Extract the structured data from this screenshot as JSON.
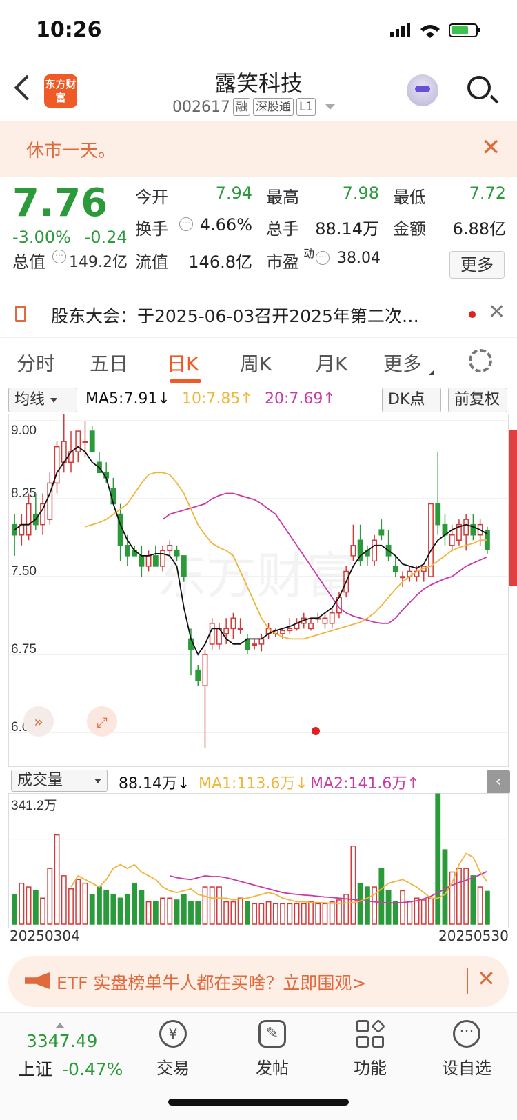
{
  "status": {
    "time": "10:26"
  },
  "header": {
    "back_icon": "chevron-left-icon",
    "logo_text": "东方财富",
    "title": "露笑科技",
    "code": "002617",
    "tags": [
      "融",
      "深股通",
      "L1"
    ]
  },
  "notice": {
    "text": "休市一天。"
  },
  "quote": {
    "price": "7.76",
    "change_pct": "-3.00%",
    "change_amt": "-0.24",
    "fields": {
      "open_label": "今开",
      "open": "7.94",
      "high_label": "最高",
      "high": "7.98",
      "low_label": "最低",
      "low": "7.72",
      "turnover_label": "换手",
      "turnover": "4.66%",
      "volume_label": "总手",
      "volume": "88.14万",
      "amount_label": "金额",
      "amount": "6.88亿",
      "mktcap_label": "总值",
      "mktcap": "149.2亿",
      "float_label": "流值",
      "float": "146.8亿",
      "pe_label": "市盈",
      "pe_sup": "动",
      "pe": "38.04"
    },
    "more_label": "更多"
  },
  "announcement": {
    "text": "股东大会：于2025-06-03召开2025年第二次…"
  },
  "tabs": [
    "分时",
    "五日",
    "日K",
    "周K",
    "月K",
    "更多"
  ],
  "active_tab": "日K",
  "ma_row": {
    "select": "均线",
    "ma5": "MA5:7.91↓",
    "ma10": "10:7.85↑",
    "ma20": "20:7.69↑",
    "dk": "DK点",
    "adjust": "前复权"
  },
  "vol_row": {
    "select": "成交量",
    "vol": "88.14万↓",
    "ma1": "MA1:113.6万↓",
    "ma2": "MA2:141.6万↑"
  },
  "colors": {
    "up": "#d23a3a",
    "down": "#2a9a3a",
    "ma5": "#111111",
    "ma10": "#f0b53a",
    "ma20": "#c83aa8",
    "accent": "#ef5a26"
  },
  "chart_data": [
    {
      "type": "candlestick",
      "y_ticks": [
        "9.00",
        "8.25",
        "7.50",
        "6.75",
        "6.00"
      ],
      "ylim": [
        6.0,
        9.0
      ],
      "x_start": "20250304",
      "x_end": "20250530",
      "watermark": "东方财富",
      "ohlc": [
        [
          8.0,
          8.1,
          7.7,
          7.9
        ],
        [
          7.9,
          8.1,
          7.8,
          8.0
        ],
        [
          7.9,
          8.3,
          7.85,
          8.2
        ],
        [
          8.1,
          8.3,
          7.95,
          8.0
        ],
        [
          8.0,
          8.3,
          7.9,
          8.2
        ],
        [
          8.05,
          8.5,
          8.0,
          8.4
        ],
        [
          8.4,
          8.8,
          8.3,
          8.75
        ],
        [
          8.6,
          9.1,
          8.5,
          8.8
        ],
        [
          8.6,
          8.9,
          8.5,
          8.7
        ],
        [
          8.7,
          8.9,
          8.6,
          8.9
        ],
        [
          8.8,
          9.0,
          8.65,
          8.8
        ],
        [
          8.9,
          8.95,
          8.7,
          8.7
        ],
        [
          8.6,
          8.7,
          8.5,
          8.5
        ],
        [
          8.5,
          8.6,
          8.4,
          8.45
        ],
        [
          8.35,
          8.45,
          8.2,
          8.2
        ],
        [
          8.1,
          8.2,
          7.65,
          7.8
        ],
        [
          7.8,
          7.9,
          7.6,
          7.7
        ],
        [
          7.75,
          7.8,
          7.7,
          7.7
        ],
        [
          7.7,
          7.8,
          7.5,
          7.6
        ],
        [
          7.6,
          7.75,
          7.55,
          7.7
        ],
        [
          7.7,
          7.8,
          7.6,
          7.6
        ],
        [
          7.6,
          7.8,
          7.55,
          7.75
        ],
        [
          7.75,
          7.85,
          7.7,
          7.8
        ],
        [
          7.75,
          7.8,
          7.65,
          7.7
        ],
        [
          7.7,
          7.7,
          7.45,
          7.5
        ],
        [
          6.9,
          7.0,
          6.55,
          6.8
        ],
        [
          6.6,
          6.65,
          6.45,
          6.5
        ],
        [
          6.45,
          6.8,
          5.85,
          6.75
        ],
        [
          6.85,
          7.1,
          6.8,
          7.05
        ],
        [
          6.85,
          7.05,
          6.8,
          7.0
        ],
        [
          6.95,
          7.1,
          6.85,
          7.0
        ],
        [
          7.0,
          7.15,
          6.9,
          7.1
        ],
        [
          7.0,
          7.1,
          6.95,
          7.0
        ],
        [
          6.9,
          6.95,
          6.75,
          6.8
        ],
        [
          6.85,
          6.9,
          6.8,
          6.85
        ],
        [
          6.85,
          6.95,
          6.78,
          6.9
        ],
        [
          6.95,
          7.05,
          6.9,
          7.0
        ],
        [
          6.95,
          7.0,
          6.92,
          6.98
        ],
        [
          6.95,
          7.0,
          6.9,
          6.98
        ],
        [
          6.98,
          7.1,
          6.95,
          7.0
        ],
        [
          7.0,
          7.1,
          6.98,
          7.05
        ],
        [
          7.05,
          7.15,
          7.0,
          7.1
        ],
        [
          7.0,
          7.1,
          6.98,
          7.05
        ],
        [
          7.1,
          7.15,
          7.05,
          7.1
        ],
        [
          7.05,
          7.15,
          7.0,
          7.1
        ],
        [
          7.05,
          7.2,
          7.0,
          7.15
        ],
        [
          7.15,
          7.35,
          7.1,
          7.3
        ],
        [
          7.35,
          7.6,
          7.3,
          7.55
        ],
        [
          7.7,
          8.0,
          7.65,
          7.8
        ],
        [
          7.85,
          8.0,
          7.6,
          7.65
        ],
        [
          7.75,
          7.8,
          7.6,
          7.7
        ],
        [
          7.65,
          7.9,
          7.6,
          7.85
        ],
        [
          7.95,
          8.05,
          7.85,
          7.9
        ],
        [
          7.8,
          7.95,
          7.65,
          7.7
        ],
        [
          7.6,
          7.7,
          7.5,
          7.55
        ],
        [
          7.5,
          7.55,
          7.4,
          7.5
        ],
        [
          7.5,
          7.6,
          7.45,
          7.55
        ],
        [
          7.5,
          7.6,
          7.45,
          7.55
        ],
        [
          7.55,
          7.6,
          7.45,
          7.6
        ],
        [
          7.5,
          8.2,
          7.5,
          8.2
        ],
        [
          8.2,
          8.7,
          7.9,
          8.0
        ],
        [
          8.0,
          8.1,
          7.8,
          7.9
        ],
        [
          7.8,
          8.0,
          7.75,
          7.9
        ],
        [
          7.85,
          8.05,
          7.8,
          8.0
        ],
        [
          7.9,
          8.1,
          7.75,
          8.05
        ],
        [
          8.0,
          8.1,
          7.85,
          7.9
        ],
        [
          7.9,
          8.05,
          7.8,
          8.0
        ],
        [
          7.94,
          7.98,
          7.72,
          7.76
        ]
      ],
      "ma5": [
        7.95,
        8.0,
        8.0,
        8.05,
        8.15,
        8.3,
        8.5,
        8.6,
        8.7,
        8.75,
        8.7,
        8.6,
        8.55,
        8.45,
        8.2,
        8.0,
        7.85,
        7.75,
        7.7,
        7.7,
        7.72,
        7.72,
        7.7,
        7.6,
        7.2,
        6.9,
        6.75,
        6.85,
        7.0,
        7.0,
        6.9,
        6.85,
        6.85,
        6.9,
        6.9,
        6.9,
        6.95,
        6.98,
        7.0,
        7.02,
        7.05,
        7.08,
        7.1,
        7.1,
        7.15,
        7.2,
        7.3,
        7.45,
        7.6,
        7.7,
        7.75,
        7.8,
        7.8,
        7.75,
        7.7,
        7.62,
        7.6,
        7.58,
        7.62,
        7.75,
        7.85,
        7.9,
        7.95,
        7.98,
        8.0,
        7.98,
        7.95,
        7.91
      ],
      "ma10": [
        7.98,
        8.0,
        8.02,
        8.05,
        8.1,
        8.15,
        8.2,
        8.3,
        8.4,
        8.48,
        8.5,
        8.5,
        8.48,
        8.4,
        8.3,
        8.15,
        8.0,
        7.9,
        7.82,
        7.78,
        7.75,
        7.7,
        7.55,
        7.4,
        7.25,
        7.1,
        7.0,
        6.95,
        6.92,
        6.9,
        6.9,
        6.9,
        6.92,
        6.94,
        6.96,
        6.98,
        7.0,
        7.02,
        7.04,
        7.06,
        7.1,
        7.15,
        7.22,
        7.3,
        7.38,
        7.45,
        7.5,
        7.55,
        7.58,
        7.6,
        7.65,
        7.7,
        7.75,
        7.78,
        7.8,
        7.82,
        7.85,
        7.85
      ],
      "ma20": [
        8.05,
        8.1,
        8.12,
        8.14,
        8.16,
        8.18,
        8.2,
        8.25,
        8.28,
        8.3,
        8.3,
        8.28,
        8.26,
        8.24,
        8.2,
        8.15,
        8.1,
        8.0,
        7.9,
        7.8,
        7.7,
        7.6,
        7.5,
        7.4,
        7.3,
        7.2,
        7.15,
        7.12,
        7.1,
        7.08,
        7.06,
        7.05,
        7.05,
        7.1,
        7.18,
        7.25,
        7.32,
        7.38,
        7.42,
        7.45,
        7.48,
        7.5,
        7.55,
        7.6,
        7.63,
        7.66,
        7.69
      ]
    },
    {
      "type": "bar",
      "y_ticks": [
        "341.2万"
      ],
      "ylim": [
        0,
        341.2
      ],
      "unit": "万",
      "values": [
        80,
        110,
        100,
        90,
        70,
        150,
        240,
        130,
        95,
        120,
        110,
        80,
        100,
        90,
        80,
        70,
        80,
        110,
        90,
        60,
        60,
        70,
        70,
        65,
        80,
        60,
        60,
        100,
        100,
        100,
        60,
        60,
        70,
        60,
        55,
        55,
        60,
        55,
        55,
        55,
        55,
        55,
        60,
        55,
        55,
        60,
        65,
        80,
        210,
        110,
        100,
        100,
        150,
        90,
        60,
        90,
        60,
        70,
        65,
        70,
        350,
        200,
        140,
        150,
        150,
        130,
        100,
        88.14
      ],
      "ma1": [
        100,
        130,
        120,
        110,
        100,
        120,
        150,
        160,
        150,
        160,
        140,
        130,
        120,
        100,
        90,
        85,
        90,
        95,
        80,
        75,
        70,
        70,
        70,
        65,
        68,
        70,
        75,
        80,
        85,
        80,
        70,
        65,
        60,
        60,
        58,
        58,
        57,
        56,
        56,
        57,
        58,
        62,
        70,
        80,
        95,
        110,
        115,
        120,
        110,
        100,
        85,
        70,
        70,
        80,
        110,
        160,
        190,
        180,
        140,
        113.6
      ],
      "ma2": [
        130,
        125,
        122,
        120,
        125,
        130,
        128,
        128,
        125,
        120,
        115,
        110,
        105,
        100,
        95,
        90,
        85,
        82,
        80,
        78,
        77,
        75,
        73,
        72,
        70,
        68,
        66,
        64,
        62,
        60,
        58,
        57,
        57,
        58,
        60,
        63,
        68,
        75,
        85,
        95,
        105,
        112,
        118,
        125,
        133,
        141.6
      ],
      "colors": {
        "up": "#d23a3a",
        "down": "#2a9a3a"
      }
    }
  ],
  "etf": {
    "text": "ETF 实盘榜单牛人都在买啥？立即围观>"
  },
  "bottom": {
    "index_value": "3347.49",
    "index_name": "上证",
    "index_change": "-0.47%",
    "nav": [
      {
        "label": "交易",
        "icon": "yen-exchange-icon"
      },
      {
        "label": "发帖",
        "icon": "edit-post-icon"
      },
      {
        "label": "功能",
        "icon": "grid-apps-icon"
      },
      {
        "label": "设自选",
        "icon": "more-dots-icon"
      }
    ]
  }
}
